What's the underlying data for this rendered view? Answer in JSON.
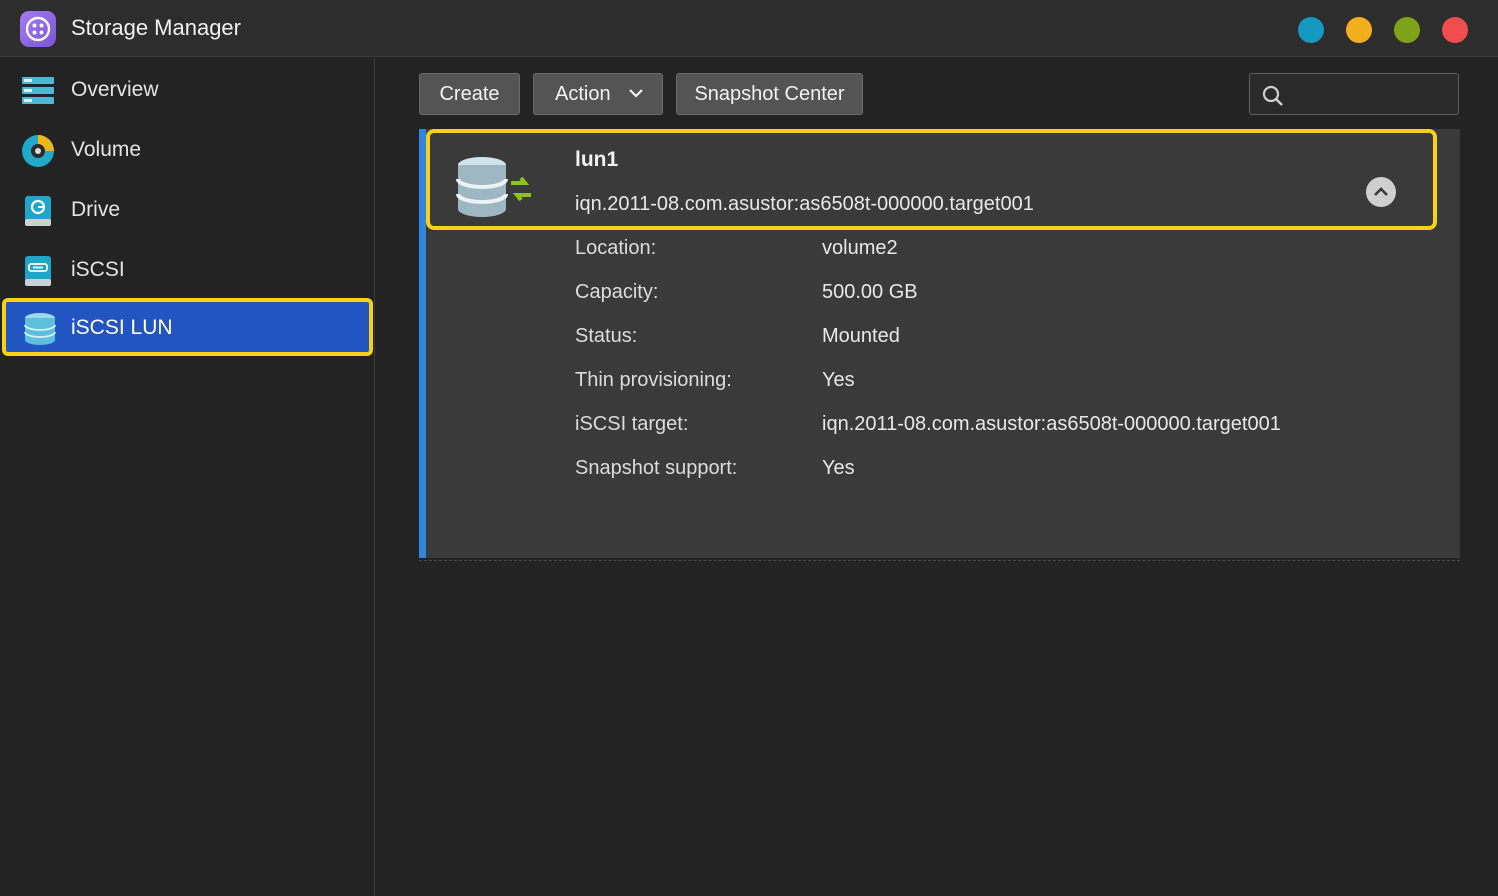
{
  "app": {
    "title": "Storage Manager",
    "icon": "app-logo-icon"
  },
  "window_controls": [
    {
      "name": "blue-dot",
      "color": "#149ac2"
    },
    {
      "name": "yellow-dot",
      "color": "#f2ae1c"
    },
    {
      "name": "green-dot",
      "color": "#7ea318"
    },
    {
      "name": "red-dot",
      "color": "#f04e4e"
    }
  ],
  "sidebar": {
    "items": [
      {
        "label": "Overview",
        "icon": "overview-icon",
        "active": false
      },
      {
        "label": "Volume",
        "icon": "volume-icon",
        "active": false
      },
      {
        "label": "Drive",
        "icon": "drive-icon",
        "active": false
      },
      {
        "label": "iSCSI",
        "icon": "iscsi-icon",
        "active": false
      },
      {
        "label": "iSCSI LUN",
        "icon": "iscsi-lun-icon",
        "active": true
      }
    ]
  },
  "toolbar": {
    "create_label": "Create",
    "action_label": "Action",
    "snapshot_center_label": "Snapshot Center",
    "search_value": ""
  },
  "lun": {
    "name": "lun1",
    "iqn": "iqn.2011-08.com.asustor:as6508t-000000.target001",
    "properties": [
      {
        "label": "Location:",
        "value": "volume2"
      },
      {
        "label": "Capacity:",
        "value": "500.00 GB"
      },
      {
        "label": "Status:",
        "value": "Mounted"
      },
      {
        "label": "Thin provisioning:",
        "value": "Yes"
      },
      {
        "label": "iSCSI target:",
        "value": "iqn.2011-08.com.asustor:as6508t-000000.target001"
      },
      {
        "label": "Snapshot support:",
        "value": "Yes"
      }
    ]
  },
  "colors": {
    "accent": "#2e86de",
    "active_nav": "#2255c2",
    "highlight": "#f7d117"
  }
}
